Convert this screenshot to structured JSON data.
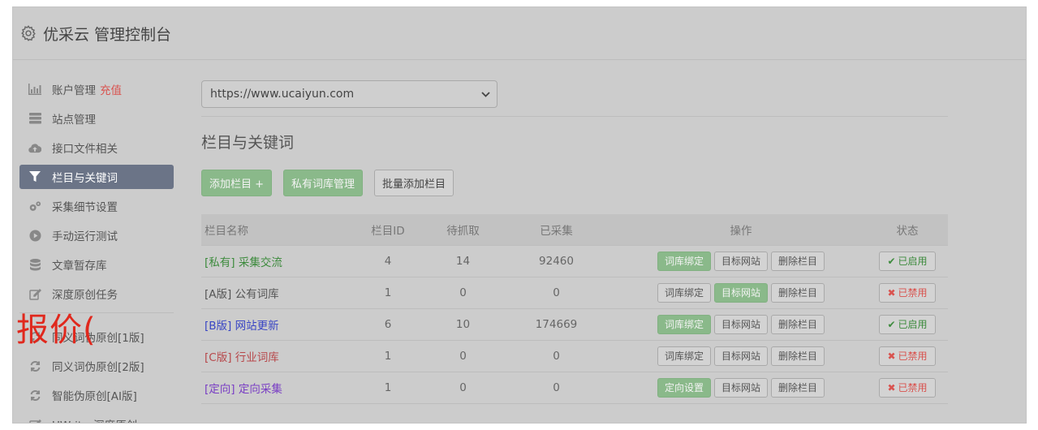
{
  "header": {
    "title": "优采云 管理控制台",
    "icon": "gear-icon"
  },
  "sidebar": {
    "items": [
      {
        "label": "账户管理",
        "extra": "充值",
        "icon": "bar-chart-icon"
      },
      {
        "label": "站点管理",
        "icon": "server-icon"
      },
      {
        "label": "接口文件相关",
        "icon": "cloud-upload-icon"
      },
      {
        "label": "栏目与关键词",
        "icon": "filter-icon",
        "active": true
      },
      {
        "label": "采集细节设置",
        "icon": "cogs-icon"
      },
      {
        "label": "手动运行测试",
        "icon": "play-circle-icon"
      },
      {
        "label": "文章暂存库",
        "icon": "database-icon"
      },
      {
        "label": "深度原创任务",
        "icon": "edit-icon"
      },
      {
        "label": "同义词伪原创[1版]",
        "icon": "refresh-icon"
      },
      {
        "label": "同义词伪原创[2版]",
        "icon": "refresh-icon"
      },
      {
        "label": "智能伪原创[AI版]",
        "icon": "refresh-icon"
      },
      {
        "label": "UWriter深度原创",
        "icon": "edit-icon"
      }
    ],
    "overlay": "报价("
  },
  "main": {
    "site_select": "https://www.ucaiyun.com",
    "section_title": "栏目与关键词",
    "buttons": {
      "add": "添加栏目 +",
      "private_lib": "私有词库管理",
      "batch_add": "批量添加栏目"
    },
    "table": {
      "headers": [
        "栏目名称",
        "栏目ID",
        "待抓取",
        "已采集",
        "操作",
        "状态"
      ],
      "rows": [
        {
          "tag": "[私有]",
          "name": "采集交流",
          "id": "4",
          "pending": "14",
          "collected": "92460",
          "op1": "词库绑定",
          "op2": "目标网站",
          "op3": "删除栏目",
          "status": "已启用",
          "name_color": "#3d8b3d",
          "op1_on": true,
          "op2_on": false,
          "enabled": true
        },
        {
          "tag": "[A版]",
          "name": "公有词库",
          "id": "1",
          "pending": "0",
          "collected": "0",
          "op1": "词库绑定",
          "op2": "目标网站",
          "op3": "删除栏目",
          "status": "已禁用",
          "name_color": "#555555",
          "op1_on": false,
          "op2_on": true,
          "enabled": false
        },
        {
          "tag": "[B版]",
          "name": "网站更新",
          "id": "6",
          "pending": "10",
          "collected": "174669",
          "op1": "词库绑定",
          "op2": "目标网站",
          "op3": "删除栏目",
          "status": "已启用",
          "name_color": "#3a46c4",
          "op1_on": true,
          "op2_on": false,
          "enabled": true
        },
        {
          "tag": "[C版]",
          "name": "行业词库",
          "id": "1",
          "pending": "0",
          "collected": "0",
          "op1": "词库绑定",
          "op2": "目标网站",
          "op3": "删除栏目",
          "status": "已禁用",
          "name_color": "#b7484b",
          "op1_on": false,
          "op2_on": false,
          "enabled": false
        },
        {
          "tag": "[定向]",
          "name": "定向采集",
          "id": "1",
          "pending": "0",
          "collected": "0",
          "op1": "定向设置",
          "op2": "目标网站",
          "op3": "删除栏目",
          "status": "已禁用",
          "name_color": "#7a3fc4",
          "op1_on": true,
          "op2_on": false,
          "enabled": false
        }
      ]
    }
  },
  "colors": {
    "enabled": "#3d8b3d",
    "disabled": "#d9534f",
    "accent_green": "#8ab98a",
    "active_nav": "#6b7487",
    "overlay": "#e0281d"
  }
}
